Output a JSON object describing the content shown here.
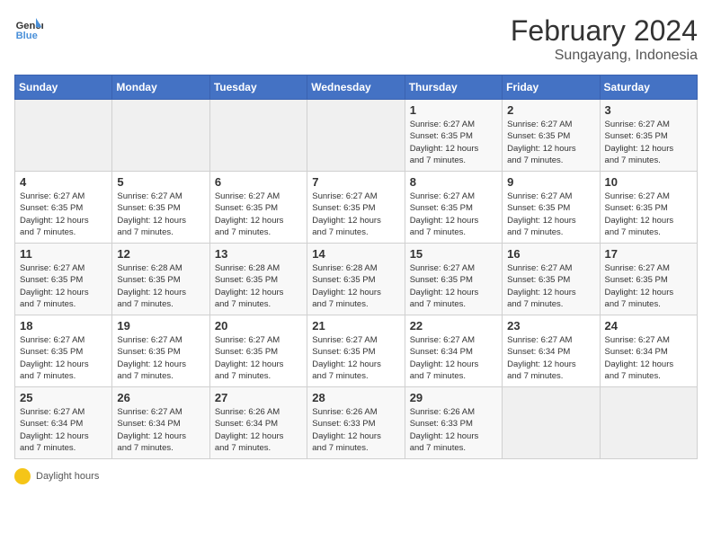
{
  "logo": {
    "text_general": "General",
    "text_blue": "Blue"
  },
  "title": "February 2024",
  "subtitle": "Sungayang, Indonesia",
  "days_of_week": [
    "Sunday",
    "Monday",
    "Tuesday",
    "Wednesday",
    "Thursday",
    "Friday",
    "Saturday"
  ],
  "weeks": [
    {
      "days": [
        {
          "number": "",
          "info": ""
        },
        {
          "number": "",
          "info": ""
        },
        {
          "number": "",
          "info": ""
        },
        {
          "number": "",
          "info": ""
        },
        {
          "number": "1",
          "info": "Sunrise: 6:27 AM\nSunset: 6:35 PM\nDaylight: 12 hours\nand 7 minutes."
        },
        {
          "number": "2",
          "info": "Sunrise: 6:27 AM\nSunset: 6:35 PM\nDaylight: 12 hours\nand 7 minutes."
        },
        {
          "number": "3",
          "info": "Sunrise: 6:27 AM\nSunset: 6:35 PM\nDaylight: 12 hours\nand 7 minutes."
        }
      ]
    },
    {
      "days": [
        {
          "number": "4",
          "info": "Sunrise: 6:27 AM\nSunset: 6:35 PM\nDaylight: 12 hours\nand 7 minutes."
        },
        {
          "number": "5",
          "info": "Sunrise: 6:27 AM\nSunset: 6:35 PM\nDaylight: 12 hours\nand 7 minutes."
        },
        {
          "number": "6",
          "info": "Sunrise: 6:27 AM\nSunset: 6:35 PM\nDaylight: 12 hours\nand 7 minutes."
        },
        {
          "number": "7",
          "info": "Sunrise: 6:27 AM\nSunset: 6:35 PM\nDaylight: 12 hours\nand 7 minutes."
        },
        {
          "number": "8",
          "info": "Sunrise: 6:27 AM\nSunset: 6:35 PM\nDaylight: 12 hours\nand 7 minutes."
        },
        {
          "number": "9",
          "info": "Sunrise: 6:27 AM\nSunset: 6:35 PM\nDaylight: 12 hours\nand 7 minutes."
        },
        {
          "number": "10",
          "info": "Sunrise: 6:27 AM\nSunset: 6:35 PM\nDaylight: 12 hours\nand 7 minutes."
        }
      ]
    },
    {
      "days": [
        {
          "number": "11",
          "info": "Sunrise: 6:27 AM\nSunset: 6:35 PM\nDaylight: 12 hours\nand 7 minutes."
        },
        {
          "number": "12",
          "info": "Sunrise: 6:28 AM\nSunset: 6:35 PM\nDaylight: 12 hours\nand 7 minutes."
        },
        {
          "number": "13",
          "info": "Sunrise: 6:28 AM\nSunset: 6:35 PM\nDaylight: 12 hours\nand 7 minutes."
        },
        {
          "number": "14",
          "info": "Sunrise: 6:28 AM\nSunset: 6:35 PM\nDaylight: 12 hours\nand 7 minutes."
        },
        {
          "number": "15",
          "info": "Sunrise: 6:27 AM\nSunset: 6:35 PM\nDaylight: 12 hours\nand 7 minutes."
        },
        {
          "number": "16",
          "info": "Sunrise: 6:27 AM\nSunset: 6:35 PM\nDaylight: 12 hours\nand 7 minutes."
        },
        {
          "number": "17",
          "info": "Sunrise: 6:27 AM\nSunset: 6:35 PM\nDaylight: 12 hours\nand 7 minutes."
        }
      ]
    },
    {
      "days": [
        {
          "number": "18",
          "info": "Sunrise: 6:27 AM\nSunset: 6:35 PM\nDaylight: 12 hours\nand 7 minutes."
        },
        {
          "number": "19",
          "info": "Sunrise: 6:27 AM\nSunset: 6:35 PM\nDaylight: 12 hours\nand 7 minutes."
        },
        {
          "number": "20",
          "info": "Sunrise: 6:27 AM\nSunset: 6:35 PM\nDaylight: 12 hours\nand 7 minutes."
        },
        {
          "number": "21",
          "info": "Sunrise: 6:27 AM\nSunset: 6:35 PM\nDaylight: 12 hours\nand 7 minutes."
        },
        {
          "number": "22",
          "info": "Sunrise: 6:27 AM\nSunset: 6:34 PM\nDaylight: 12 hours\nand 7 minutes."
        },
        {
          "number": "23",
          "info": "Sunrise: 6:27 AM\nSunset: 6:34 PM\nDaylight: 12 hours\nand 7 minutes."
        },
        {
          "number": "24",
          "info": "Sunrise: 6:27 AM\nSunset: 6:34 PM\nDaylight: 12 hours\nand 7 minutes."
        }
      ]
    },
    {
      "days": [
        {
          "number": "25",
          "info": "Sunrise: 6:27 AM\nSunset: 6:34 PM\nDaylight: 12 hours\nand 7 minutes."
        },
        {
          "number": "26",
          "info": "Sunrise: 6:27 AM\nSunset: 6:34 PM\nDaylight: 12 hours\nand 7 minutes."
        },
        {
          "number": "27",
          "info": "Sunrise: 6:26 AM\nSunset: 6:34 PM\nDaylight: 12 hours\nand 7 minutes."
        },
        {
          "number": "28",
          "info": "Sunrise: 6:26 AM\nSunset: 6:33 PM\nDaylight: 12 hours\nand 7 minutes."
        },
        {
          "number": "29",
          "info": "Sunrise: 6:26 AM\nSunset: 6:33 PM\nDaylight: 12 hours\nand 7 minutes."
        },
        {
          "number": "",
          "info": ""
        },
        {
          "number": "",
          "info": ""
        }
      ]
    }
  ],
  "footer": {
    "icon_label": "sun-icon",
    "text": "Daylight hours"
  }
}
